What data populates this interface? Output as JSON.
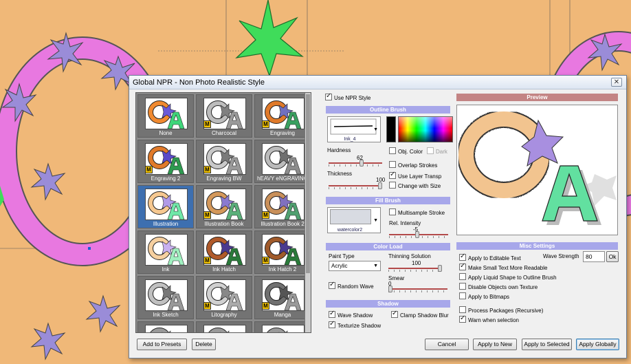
{
  "dialog": {
    "title": "Global NPR - Non Photo Realistic Style",
    "close_glyph": "✕"
  },
  "presets": [
    {
      "label": "None",
      "m": false
    },
    {
      "label": "Charcocal",
      "m": true
    },
    {
      "label": "Engraving",
      "m": true
    },
    {
      "label": "Engraving 2",
      "m": true
    },
    {
      "label": "Engraving BW",
      "m": true
    },
    {
      "label": "hEAVY eNGRAVING",
      "m": false
    },
    {
      "label": "Illustration",
      "m": false
    },
    {
      "label": "Illustration Book",
      "m": true
    },
    {
      "label": "Illustration Book 2",
      "m": true
    },
    {
      "label": "Ink",
      "m": false
    },
    {
      "label": "Ink Hatch",
      "m": true
    },
    {
      "label": "Ink Hatch 2",
      "m": true
    },
    {
      "label": "Ink Sketch",
      "m": false
    },
    {
      "label": "Litography",
      "m": true
    },
    {
      "label": "Manga",
      "m": true
    },
    {
      "label": "",
      "m": false
    },
    {
      "label": "",
      "m": false
    },
    {
      "label": "",
      "m": false
    }
  ],
  "preset_badge": "M",
  "npr": {
    "use_npr_label": "Use NPR Style",
    "outline_brush": {
      "header": "Outline Brush",
      "brush_name": "Ink_4",
      "obj_color_label": "Obj. Color",
      "dark_label": "Dark",
      "hardness_label": "Hardness",
      "hardness_value": "62",
      "hardness_level": 0.62,
      "thickness_label": "Thickness",
      "thickness_value": "100",
      "thickness_level": 1.0,
      "overlap_label": "Overlap Strokes",
      "layer_transp_label": "Use Layer Transp",
      "change_size_label": "Change with Size"
    },
    "fill_brush": {
      "header": "Fill Brush",
      "brush_name": "watercolor2",
      "multisample_label": "Multisample Stroke",
      "rel_intensity_label": "Rel. Intensity",
      "rel_intensity_value": "-5",
      "rel_intensity_level": 0.47
    },
    "color_load": {
      "header": "Color Load",
      "paint_type_label": "Paint Type",
      "paint_type_value": "Acrylic",
      "thinning_label": "Thinning Solution",
      "thinning_value": "100",
      "thinning_level": 1.0,
      "smear_label": "Smear",
      "smear_value": "0",
      "smear_level": 0.0,
      "random_wave_label": "Random Wave"
    },
    "shadow": {
      "header": "Shadow",
      "wave_shadow_label": "Wave Shadow",
      "clamp_label": "Clamp Shadow Blur",
      "texturize_label": "Texturize Shadow"
    }
  },
  "preview": {
    "header": "Preview"
  },
  "misc": {
    "header": "Misc Settings",
    "wave_strength_label": "Wave Strength",
    "wave_strength_value": "80",
    "ok_label": "Ok",
    "items": [
      {
        "label": "Apply to Editable Text",
        "checked": true
      },
      {
        "label": "Make Small Text More Readable",
        "checked": true
      },
      {
        "label": "Apply Liquid Shape to Outline Brush",
        "checked": false
      },
      {
        "label": "Disable Objects own Texture",
        "checked": false
      },
      {
        "label": "Apply to Bitmaps",
        "checked": false
      }
    ],
    "items2": [
      {
        "label": "Process Packages (Recursive)",
        "checked": false
      },
      {
        "label": "Warn when selection",
        "checked": true
      }
    ]
  },
  "buttons": {
    "add_presets": "Add to Presets",
    "delete": "Delete",
    "cancel": "Cancel",
    "apply_new": "Apply to New",
    "apply_selected": "Apply to Selected",
    "apply_globally": "Apply Globally"
  },
  "colors": {
    "background": "#f0b878",
    "ring": "#e878e0",
    "star_purple": "#9a8cd8",
    "star_green": "#3fdc5a",
    "section_header": "#a7a7ea",
    "preview_header": "#c38484"
  }
}
